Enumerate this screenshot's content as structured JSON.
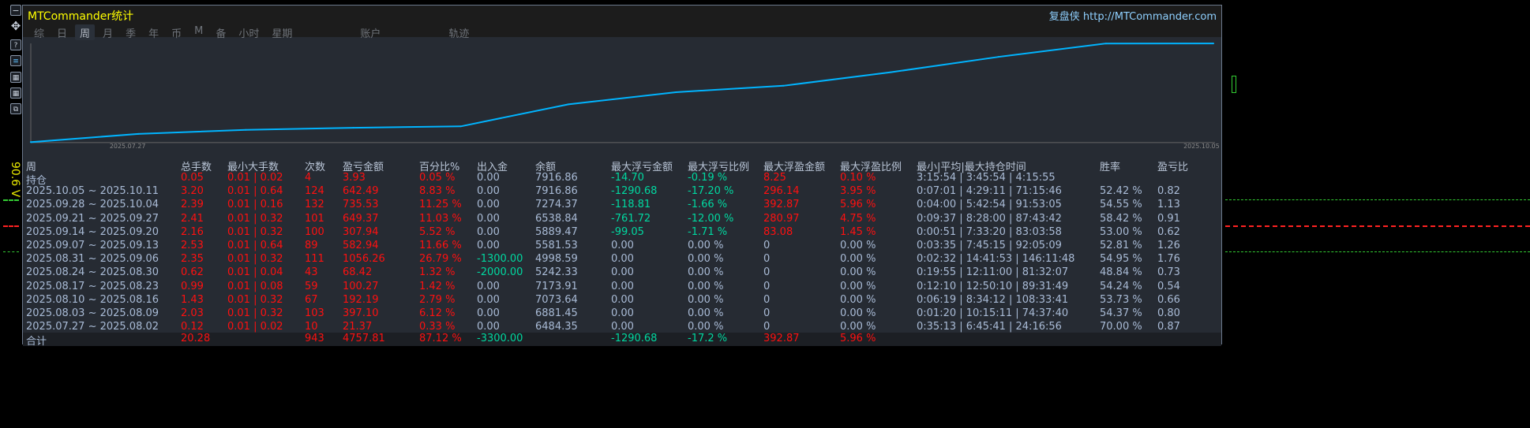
{
  "window": {
    "title": "MTCommander统计",
    "site": "复盘侠 http://MTCommander.com",
    "side_label": "90.6 V"
  },
  "tabs": [
    {
      "label": "综"
    },
    {
      "label": "日"
    },
    {
      "label": "周",
      "active": true
    },
    {
      "label": "月"
    },
    {
      "label": "季"
    },
    {
      "label": "年"
    },
    {
      "label": "币"
    },
    {
      "label": "M"
    },
    {
      "label": "备"
    },
    {
      "label": "小时"
    },
    {
      "label": "星期"
    },
    {
      "label": "账户"
    },
    {
      "label": "轨迹"
    }
  ],
  "chart_data": {
    "type": "line",
    "x_start_label": "2025.07.27",
    "x_end_label": "2025.10.05",
    "color": "#00b4ff",
    "x": [
      "2025.07.27",
      "2025.08.03",
      "2025.08.10",
      "2025.08.17",
      "2025.08.24",
      "2025.08.31",
      "2025.09.07",
      "2025.09.14",
      "2025.09.21",
      "2025.09.28",
      "2025.10.05",
      "持仓"
    ],
    "values": [
      21.37,
      418.78,
      610.97,
      711.24,
      779.66,
      1835.92,
      2418.86,
      2726.8,
      3376.17,
      4111.7,
      4754.19,
      4758.12
    ]
  },
  "table": {
    "headers": [
      "周",
      "总手数",
      "最小大手数",
      "次数",
      "盈亏金额",
      "百分比%",
      "出入金",
      "余额",
      "最大浮亏金额",
      "最大浮亏比例",
      "最大浮盈金额",
      "最大浮盈比例",
      "最小|平均|最大持仓时间",
      "胜率",
      "盈亏比"
    ],
    "rows": [
      [
        "持仓",
        "0.05",
        "0.01 | 0.02",
        "4",
        "3.93",
        "0.05 %",
        "0.00",
        "7916.86",
        "-14.70",
        "-0.19 %",
        "8.25",
        "0.10 %",
        "3:15:54 | 3:45:54 | 4:15:55",
        "",
        ""
      ],
      [
        "2025.10.05 ~ 2025.10.11",
        "3.20",
        "0.01 | 0.64",
        "124",
        "642.49",
        "8.83 %",
        "0.00",
        "7916.86",
        "-1290.68",
        "-17.20 %",
        "296.14",
        "3.95 %",
        "0:07:01 | 4:29:11 | 71:15:46",
        "52.42 %",
        "0.82"
      ],
      [
        "2025.09.28 ~ 2025.10.04",
        "2.39",
        "0.01 | 0.16",
        "132",
        "735.53",
        "11.25 %",
        "0.00",
        "7274.37",
        "-118.81",
        "-1.66 %",
        "392.87",
        "5.96 %",
        "0:04:00 | 5:42:54 | 91:53:05",
        "54.55 %",
        "1.13"
      ],
      [
        "2025.09.21 ~ 2025.09.27",
        "2.41",
        "0.01 | 0.32",
        "101",
        "649.37",
        "11.03 %",
        "0.00",
        "6538.84",
        "-761.72",
        "-12.00 %",
        "280.97",
        "4.75 %",
        "0:09:37 | 8:28:00 | 87:43:42",
        "58.42 %",
        "0.91"
      ],
      [
        "2025.09.14 ~ 2025.09.20",
        "2.16",
        "0.01 | 0.32",
        "100",
        "307.94",
        "5.52 %",
        "0.00",
        "5889.47",
        "-99.05",
        "-1.71 %",
        "83.08",
        "1.45 %",
        "0:00:51 | 7:33:20 | 83:03:58",
        "53.00 %",
        "0.62"
      ],
      [
        "2025.09.07 ~ 2025.09.13",
        "2.53",
        "0.01 | 0.64",
        "89",
        "582.94",
        "11.66 %",
        "0.00",
        "5581.53",
        "0.00",
        "0.00 %",
        "0",
        "0.00 %",
        "0:03:35 | 7:45:15 | 92:05:09",
        "52.81 %",
        "1.26"
      ],
      [
        "2025.08.31 ~ 2025.09.06",
        "2.35",
        "0.01 | 0.32",
        "111",
        "1056.26",
        "26.79 %",
        "-1300.00",
        "4998.59",
        "0.00",
        "0.00 %",
        "0",
        "0.00 %",
        "0:02:32 | 14:41:53 | 146:11:48",
        "54.95 %",
        "1.76"
      ],
      [
        "2025.08.24 ~ 2025.08.30",
        "0.62",
        "0.01 | 0.04",
        "43",
        "68.42",
        "1.32 %",
        "-2000.00",
        "5242.33",
        "0.00",
        "0.00 %",
        "0",
        "0.00 %",
        "0:19:55 | 12:11:00 | 81:32:07",
        "48.84 %",
        "0.73"
      ],
      [
        "2025.08.17 ~ 2025.08.23",
        "0.99",
        "0.01 | 0.08",
        "59",
        "100.27",
        "1.42 %",
        "0.00",
        "7173.91",
        "0.00",
        "0.00 %",
        "0",
        "0.00 %",
        "0:12:10 | 12:50:10 | 89:31:49",
        "54.24 %",
        "0.54"
      ],
      [
        "2025.08.10 ~ 2025.08.16",
        "1.43",
        "0.01 | 0.32",
        "67",
        "192.19",
        "2.79 %",
        "0.00",
        "7073.64",
        "0.00",
        "0.00 %",
        "0",
        "0.00 %",
        "0:06:19 | 8:34:12 | 108:33:41",
        "53.73 %",
        "0.66"
      ],
      [
        "2025.08.03 ~ 2025.08.09",
        "2.03",
        "0.01 | 0.32",
        "103",
        "397.10",
        "6.12 %",
        "0.00",
        "6881.45",
        "0.00",
        "0.00 %",
        "0",
        "0.00 %",
        "0:01:20 | 10:15:11 | 74:37:40",
        "54.37 %",
        "0.80"
      ],
      [
        "2025.07.27 ~ 2025.08.02",
        "0.12",
        "0.01 | 0.02",
        "10",
        "21.37",
        "0.33 %",
        "0.00",
        "6484.35",
        "0.00",
        "0.00 %",
        "0",
        "0.00 %",
        "0:35:13 | 6:45:41 | 24:16:56",
        "70.00 %",
        "0.87"
      ]
    ],
    "total": [
      "合计",
      "20.28",
      "",
      "943",
      "4757.81",
      "87.12 %",
      "-3300.00",
      "",
      "-1290.68",
      "-17.2 %",
      "392.87",
      "5.96 %",
      "",
      "",
      ""
    ]
  }
}
